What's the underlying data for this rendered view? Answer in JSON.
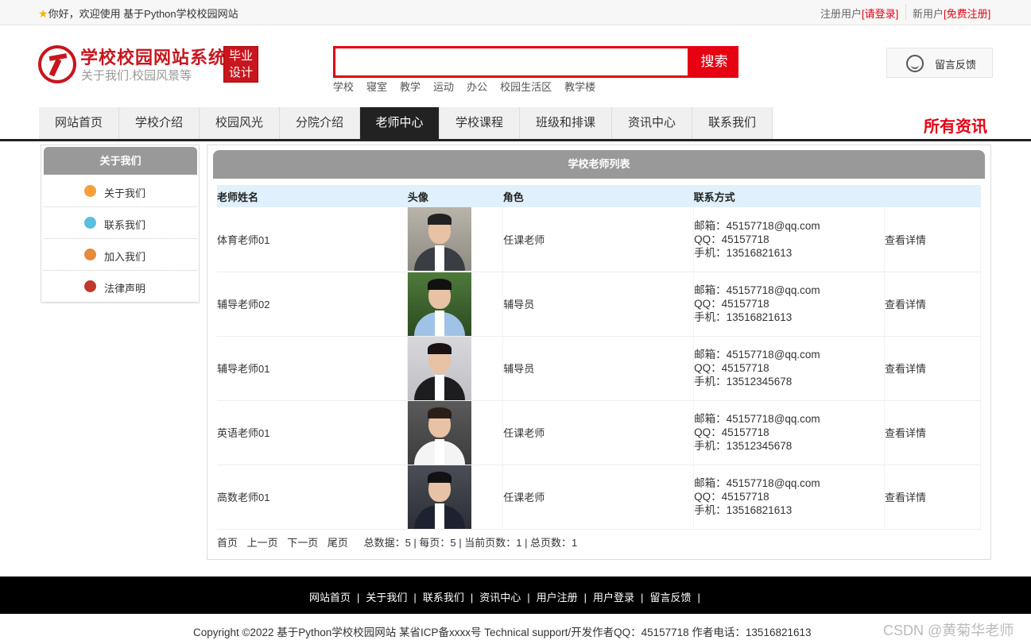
{
  "topbar": {
    "greeting": "你好，欢迎使用 基于Python学校校园网站",
    "register_prefix": "注册用户",
    "login_link": "[请登录]",
    "new_user_prefix": "新用户",
    "free_register_link": "[免费注册]"
  },
  "brand": {
    "title": "学校校园网站系统",
    "subtitle": "关于我们.校园风景等",
    "badge_line1": "毕业",
    "badge_line2": "设计"
  },
  "search": {
    "value": "",
    "placeholder": "",
    "button": "搜索",
    "hot_words": [
      "学校",
      "寝室",
      "教学",
      "运动",
      "办公",
      "校园生活区",
      "教学楼"
    ]
  },
  "feedback": {
    "label": "留言反馈"
  },
  "nav": {
    "items": [
      "网站首页",
      "学校介绍",
      "校园风光",
      "分院介绍",
      "老师中心",
      "学校课程",
      "班级和排课",
      "资讯中心",
      "联系我们"
    ],
    "active": "老师中心",
    "all_news": "所有资讯"
  },
  "sidebar": {
    "title": "关于我们",
    "items": [
      {
        "label": "关于我们",
        "icon": "orange-circle-icon",
        "color": "#f5a03c"
      },
      {
        "label": "联系我们",
        "icon": "clipboard-icon",
        "color": "#5bc0de"
      },
      {
        "label": "加入我们",
        "icon": "lock-icon",
        "color": "#e8893c"
      },
      {
        "label": "法律声明",
        "icon": "power-icon",
        "color": "#c0392b"
      }
    ]
  },
  "main": {
    "title": "学校老师列表",
    "columns": [
      "老师姓名",
      "头像",
      "角色",
      "联系方式",
      ""
    ],
    "rows": [
      {
        "name": "体育老师01",
        "role": "任课老师",
        "email": "邮箱：45157718@qq.com",
        "qq": "QQ：45157718",
        "phone": "手机：13516821613",
        "action": "查看详情"
      },
      {
        "name": "辅导老师02",
        "role": "辅导员",
        "email": "邮箱：45157718@qq.com",
        "qq": "QQ：45157718",
        "phone": "手机：13516821613",
        "action": "查看详情"
      },
      {
        "name": "辅导老师01",
        "role": "辅导员",
        "email": "邮箱：45157718@qq.com",
        "qq": "QQ：45157718",
        "phone": "手机：13512345678",
        "action": "查看详情"
      },
      {
        "name": "英语老师01",
        "role": "任课老师",
        "email": "邮箱：45157718@qq.com",
        "qq": "QQ：45157718",
        "phone": "手机：13512345678",
        "action": "查看详情"
      },
      {
        "name": "高数老师01",
        "role": "任课老师",
        "email": "邮箱：45157718@qq.com",
        "qq": "QQ：45157718",
        "phone": "手机：13516821613",
        "action": "查看详情"
      }
    ],
    "pager": {
      "first": "首页",
      "prev": "上一页",
      "next": "下一页",
      "last": "尾页",
      "summary": "总数据：5 | 每页：5 | 当前页数：1 | 总页数：1"
    }
  },
  "footer": {
    "links": [
      "网站首页",
      "关于我们",
      "联系我们",
      "资讯中心",
      "用户注册",
      "用户登录",
      "留言反馈"
    ],
    "copyright": "Copyright ©2022 基于Python学校校园网站 某省ICP备xxxx号    Technical support/开发作者QQ：45157718     作者电话：13516821613",
    "watermark": "CSDN @黄菊华老师"
  },
  "colors": {
    "accent_red": "#e60012",
    "brand_red": "#c8161e",
    "nav_active": "#222222",
    "header_gray": "#999999",
    "table_header": "#e0f0fc"
  }
}
